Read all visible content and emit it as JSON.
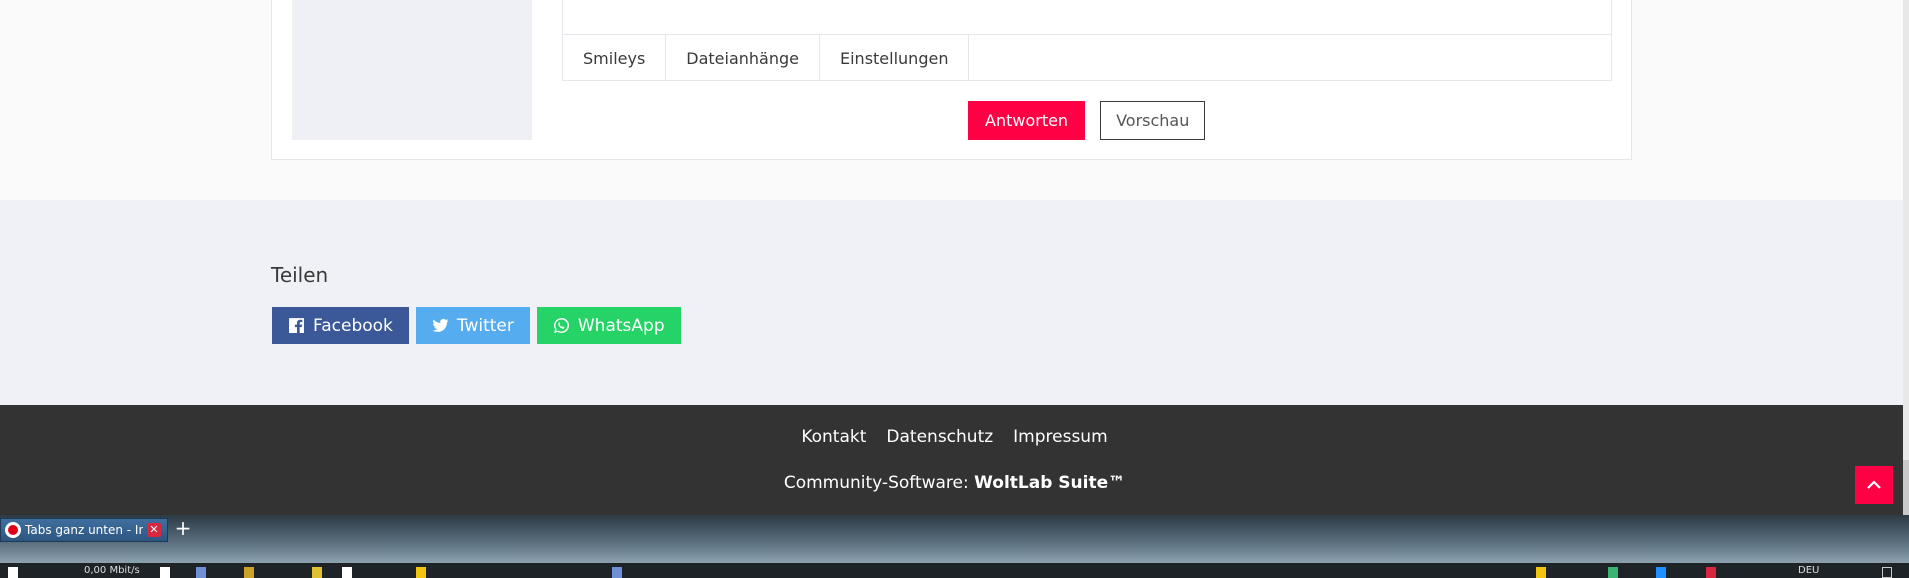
{
  "editor": {
    "tabs": [
      "Smileys",
      "Dateianhänge",
      "Einstellungen"
    ]
  },
  "form": {
    "submit_label": "Antworten",
    "preview_label": "Vorschau"
  },
  "share": {
    "title": "Teilen",
    "buttons": [
      {
        "label": "Facebook",
        "icon": "facebook-icon",
        "color": "#3b5998"
      },
      {
        "label": "Twitter",
        "icon": "twitter-icon",
        "color": "#55acee"
      },
      {
        "label": "WhatsApp",
        "icon": "whatsapp-icon",
        "color": "#25d366"
      }
    ]
  },
  "footer": {
    "links": [
      "Kontakt",
      "Datenschutz",
      "Impressum"
    ],
    "copyright_prefix": "Community-Software: ",
    "copyright_brand": "WoltLab Suite™",
    "scroll_top_icon": "chevron-up-icon"
  },
  "colors": {
    "accent": "#ff0045",
    "footer_bg": "#333333",
    "page_bg": "#f0f1f6"
  },
  "browser": {
    "tab_title": "Tabs ganz unten - In",
    "new_tab_label": "+"
  },
  "taskbar": {
    "net_speed": "0,00 Mbit/s",
    "lang": "DEU"
  }
}
